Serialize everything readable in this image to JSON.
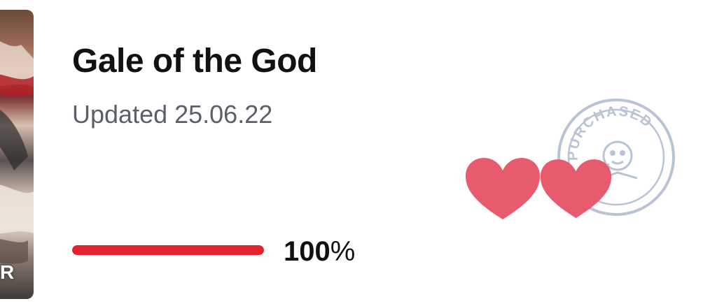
{
  "comic": {
    "title": "Gale of the God",
    "updated": "Updated 25.06.22",
    "thumbnail_badge": "R"
  },
  "progress": {
    "value_fraction": 1.0,
    "label_number": "100",
    "label_unit": "%"
  },
  "stamp": {
    "text": "PURCHASED",
    "icon": "smiley-face-icon"
  },
  "icons": {
    "heart_left": "heart-icon",
    "heart_right": "heart-icon"
  },
  "colors": {
    "accent_red": "#e3242e",
    "heart_pink": "#e85a6e",
    "stamp_blue": "#b8c4d6",
    "title_text": "#111111",
    "secondary_text": "#5a5f6a"
  }
}
